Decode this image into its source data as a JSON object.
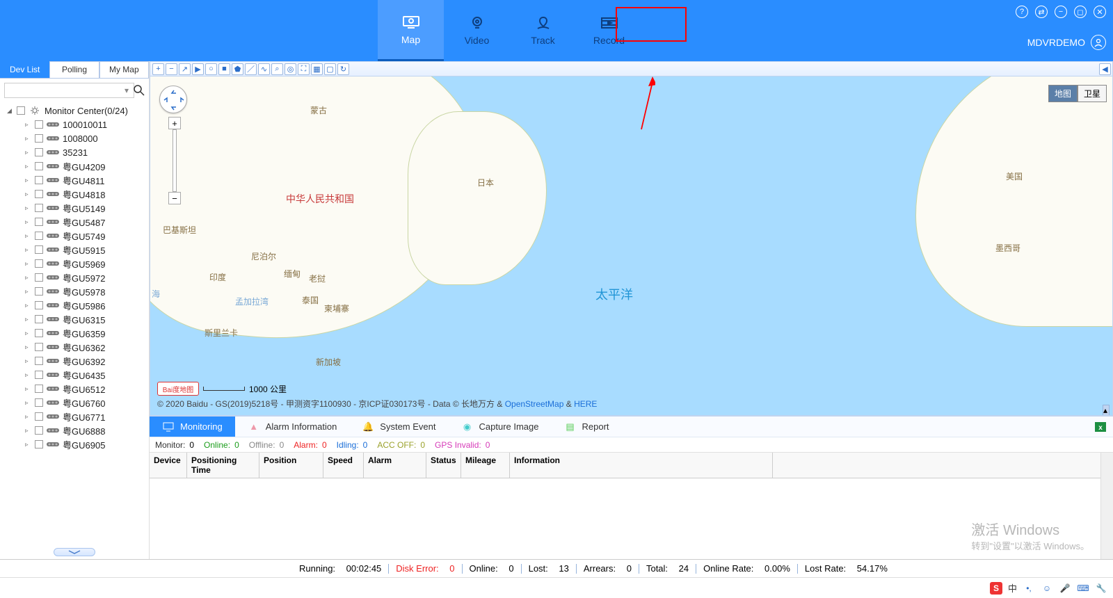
{
  "header": {
    "nav": {
      "map": "Map",
      "video": "Video",
      "track": "Track",
      "record": "Record"
    },
    "user": "MDVRDEMO"
  },
  "sidebar": {
    "tabs": {
      "dev": "Dev List",
      "poll": "Polling",
      "mymap": "My Map"
    },
    "root": "Monitor Center(0/24)",
    "devices": [
      "100010011",
      "1008000",
      "35231",
      "粤GU4209",
      "粤GU4811",
      "粤GU4818",
      "粤GU5149",
      "粤GU5487",
      "粤GU5749",
      "粤GU5915",
      "粤GU5969",
      "粤GU5972",
      "粤GU5978",
      "粤GU5986",
      "粤GU6315",
      "粤GU6359",
      "粤GU6362",
      "粤GU6392",
      "粤GU6435",
      "粤GU6512",
      "粤GU6760",
      "粤GU6771",
      "粤GU6888",
      "粤GU6905"
    ]
  },
  "map": {
    "labels": {
      "mongolia": "蒙古",
      "china": "中华人民共和国",
      "japan": "日本",
      "pakistan": "巴基斯坦",
      "nepal": "尼泊尔",
      "india": "印度",
      "myanmar": "缅甸",
      "laos": "老挝",
      "thailand": "泰国",
      "cambodia": "柬埔寨",
      "bengal": "孟加拉湾",
      "srilanka": "斯里兰卡",
      "singapore": "新加坡",
      "pacific": "太平洋",
      "usa": "美国",
      "mexico": "墨西哥",
      "sea": "海"
    },
    "type": {
      "normal": "地图",
      "satellite": "卫星"
    },
    "scale": "1000 公里",
    "baidu": "Bai度地图",
    "copyright": "© 2020 Baidu - GS(2019)5218号 - 甲测资字1100930 - 京ICP证030173号 - Data © 长地万方 & ",
    "osm": "OpenStreetMap",
    "here": "HERE",
    "amp": " & "
  },
  "bottom": {
    "tabs": {
      "monitoring": "Monitoring",
      "alarm": "Alarm Information",
      "system": "System Event",
      "capture": "Capture Image",
      "report": "Report"
    },
    "stats": {
      "monitorL": "Monitor:",
      "monitorV": "0",
      "onlineL": "Online:",
      "onlineV": "0",
      "offlineL": "Offline:",
      "offlineV": "0",
      "alarmL": "Alarm:",
      "alarmV": "0",
      "idlingL": "Idling:",
      "idlingV": "0",
      "accL": "ACC OFF:",
      "accV": "0",
      "gpsL": "GPS Invalid:",
      "gpsV": "0"
    },
    "cols": {
      "device": "Device",
      "time": "Positioning Time",
      "pos": "Position",
      "speed": "Speed",
      "alarm": "Alarm",
      "status": "Status",
      "mileage": "Mileage",
      "info": "Information"
    }
  },
  "watermark": {
    "title": "激活 Windows",
    "sub": "转到\"设置\"以激活 Windows。"
  },
  "statusbar": {
    "runningL": "Running:",
    "runningV": "00:02:45",
    "diskL": "Disk Error:",
    "diskV": "0",
    "onlineL": "Online:",
    "onlineV": "0",
    "lostL": "Lost:",
    "lostV": "13",
    "arrearsL": "Arrears:",
    "arrearsV": "0",
    "totalL": "Total:",
    "totalV": "24",
    "onlineRateL": "Online Rate:",
    "onlineRateV": "0.00%",
    "lostRateL": "Lost Rate:",
    "lostRateV": "54.17%"
  },
  "taskbar": {
    "ime": "中"
  }
}
